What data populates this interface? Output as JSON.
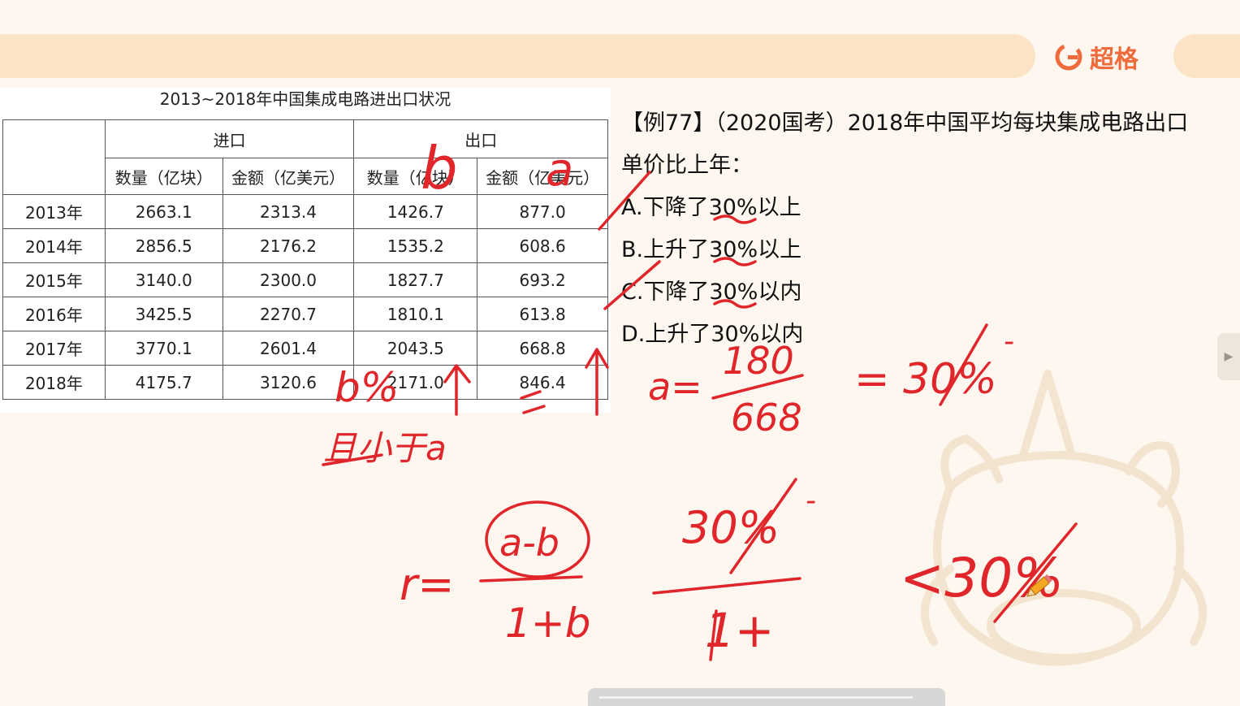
{
  "brand": {
    "name": "超格",
    "color": "#ef6b3c"
  },
  "table": {
    "title": "2013~2018年中国集成电路进出口状况",
    "import_header": "进口",
    "export_header": "出口",
    "subheaders": [
      "数量（亿块）",
      "金额（亿美元）",
      "数量（亿块）",
      "金额（亿美元）"
    ],
    "rows": [
      {
        "year": "2013年",
        "import_qty": "2663.1",
        "import_amt": "2313.4",
        "export_qty": "1426.7",
        "export_amt": "877.0"
      },
      {
        "year": "2014年",
        "import_qty": "2856.5",
        "import_amt": "2176.2",
        "export_qty": "1535.2",
        "export_amt": "608.6"
      },
      {
        "year": "2015年",
        "import_qty": "3140.0",
        "import_amt": "2300.0",
        "export_qty": "1827.7",
        "export_amt": "693.2"
      },
      {
        "year": "2016年",
        "import_qty": "3425.5",
        "import_amt": "2270.7",
        "export_qty": "1810.1",
        "export_amt": "613.8"
      },
      {
        "year": "2017年",
        "import_qty": "3770.1",
        "import_amt": "2601.4",
        "export_qty": "2043.5",
        "export_amt": "668.8"
      },
      {
        "year": "2018年",
        "import_qty": "4175.7",
        "import_amt": "3120.6",
        "export_qty": "2171.0",
        "export_amt": "846.4"
      }
    ]
  },
  "question": {
    "stem": "【例77】（2020国考）2018年中国平均每块集成电路出口单价比上年：",
    "options": [
      "A.下降了30%以上",
      "B.上升了30%以上",
      "C.下降了30%以内",
      "D.上升了30%以内"
    ]
  },
  "handwriting": {
    "ink_color": "#e0262b",
    "label_b": "b",
    "label_a": "a",
    "note_b": "b%",
    "note_small": "且小于a",
    "eq1_lhs": "a=",
    "eq1_num": "180",
    "eq1_den": "668",
    "eq1_rhs": "= 30%",
    "eq1_sup": "-",
    "eq2_lhs": "r=",
    "eq2_num": "a-b",
    "eq2_den": "1+b",
    "eq3_num": "30%",
    "eq3_sup": "-",
    "eq3_den": "1+",
    "eq4": "<30%"
  }
}
